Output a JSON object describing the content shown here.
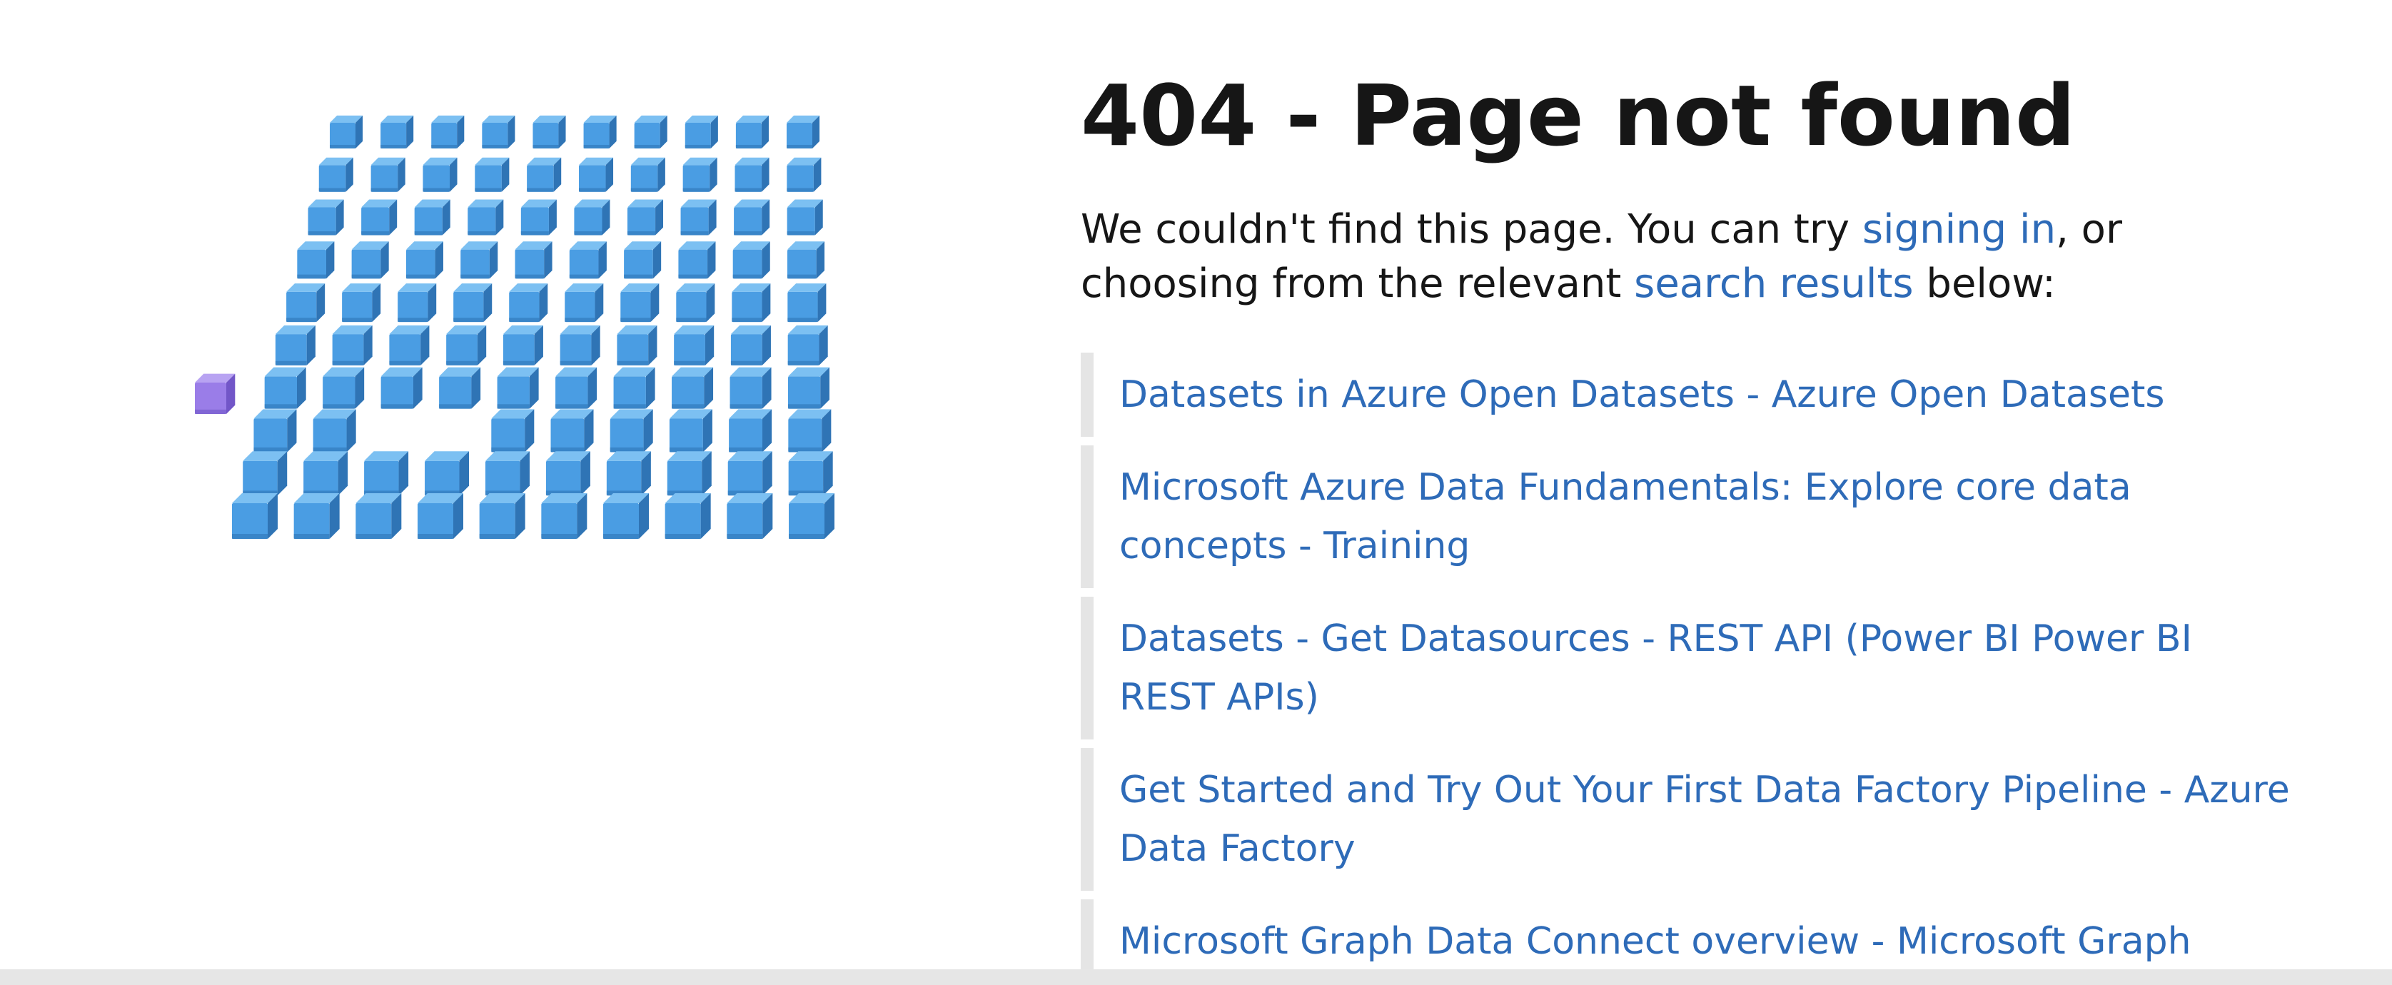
{
  "page": {
    "title": "404 - Page not found",
    "intro": {
      "before_sign_in": "We couldn't find this page. You can try ",
      "sign_in_link": "signing in",
      "between": ", or choosing from the relevant ",
      "search_link": "search results",
      "after": " below:"
    },
    "results": [
      {
        "label": "Datasets in Azure Open Datasets - Azure Open Datasets"
      },
      {
        "label": "Microsoft Azure Data Fundamentals: Explore core data concepts - Training"
      },
      {
        "label": "Datasets - Get Datasources - REST API (Power BI Power BI REST APIs)"
      },
      {
        "label": "Get Started and Try Out Your First Data Factory Pipeline - Azure Data Factory"
      },
      {
        "label": "Microsoft Graph Data Connect overview - Microsoft Graph"
      }
    ]
  },
  "illustration": {
    "icon": "cube-grid-missing-block-illustration",
    "cube_color": "#4a9de3",
    "cube_top_color": "#7cc0f2",
    "cube_side_color": "#2f74b5",
    "odd_cube_color": "#9a7de8"
  }
}
